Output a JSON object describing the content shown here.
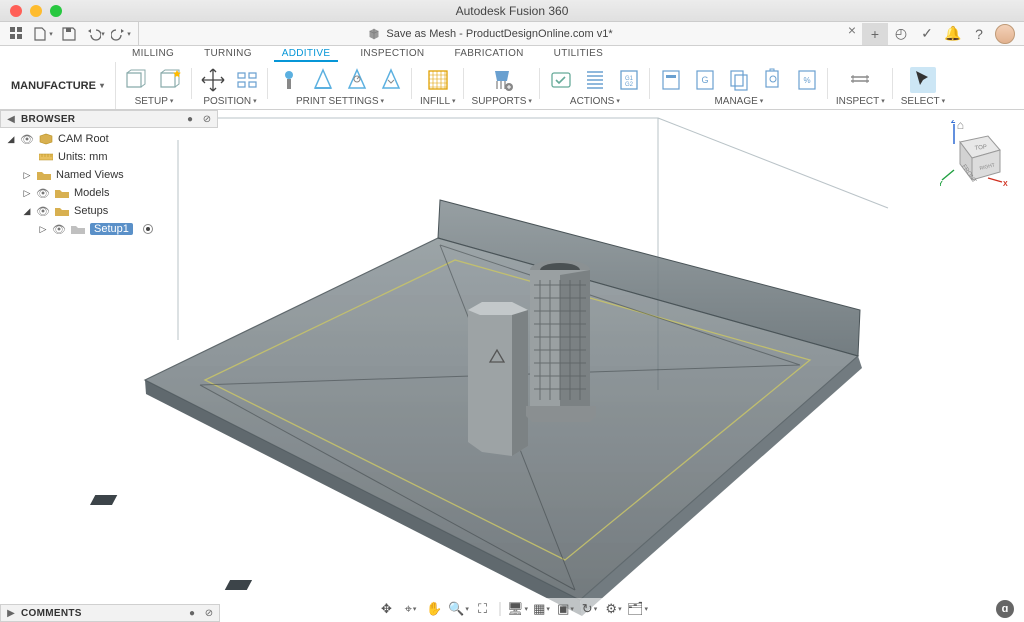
{
  "app": {
    "title": "Autodesk Fusion 360"
  },
  "document": {
    "tab_title": "Save as Mesh - ProductDesignOnline.com v1*"
  },
  "workspace": {
    "current": "MANUFACTURE",
    "tabs": [
      "MILLING",
      "TURNING",
      "ADDITIVE",
      "INSPECTION",
      "FABRICATION",
      "UTILITIES"
    ],
    "active_tab_index": 2
  },
  "ribbon": {
    "setup_label": "SETUP",
    "position_label": "POSITION",
    "printsettings_label": "PRINT SETTINGS",
    "infill_label": "INFILL",
    "supports_label": "SUPPORTS",
    "actions_label": "ACTIONS",
    "manage_label": "MANAGE",
    "inspect_label": "INSPECT",
    "select_label": "SELECT"
  },
  "browser": {
    "header": "BROWSER",
    "root": "CAM Root",
    "units": "Units: mm",
    "named_views": "Named Views",
    "models": "Models",
    "setups": "Setups",
    "setup1": "Setup1"
  },
  "viewcube": {
    "front": "FRONT",
    "top": "TOP",
    "right": "RIGHT",
    "x": "X",
    "y": "Y",
    "z": "Z"
  },
  "comments": {
    "header": "COMMENTS"
  },
  "colors": {
    "accent": "#0696d7"
  }
}
